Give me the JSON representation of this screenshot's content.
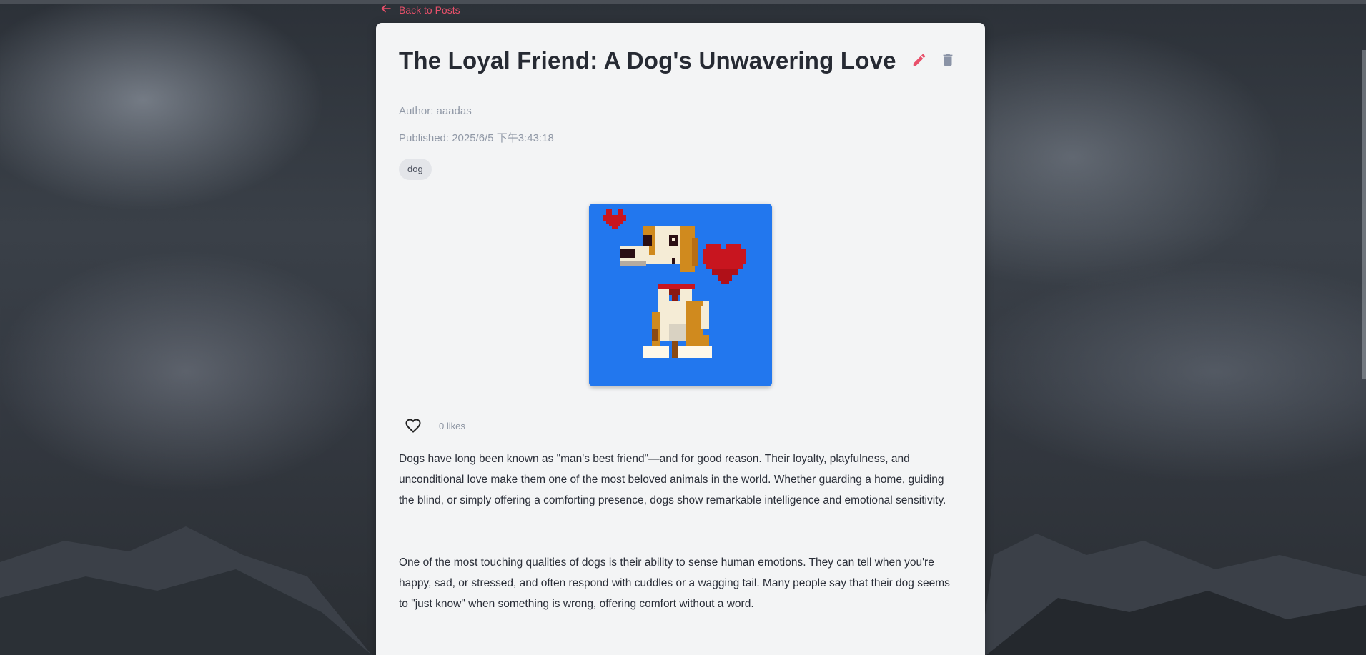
{
  "nav": {
    "back_label": "Back to Posts"
  },
  "post": {
    "title": "The Loyal Friend: A Dog's Unwavering Love",
    "author_line": "Author: aaadas",
    "published_line": "Published: 2025/6/5 下午3:43:18",
    "tags": [
      "dog"
    ],
    "likes_text": "0 likes",
    "paragraphs": [
      "Dogs have long been known as \"man's best friend\"—and for good reason. Their loyalty, playfulness, and unconditional love make them one of the most beloved animals in the world. Whether guarding a home, guiding the blind, or simply offering a comforting presence, dogs show remarkable intelligence and emotional sensitivity.",
      "One of the most touching qualities of dogs is their ability to sense human emotions. They can tell when you're happy, sad, or stressed, and often respond with cuddles or a wagging tail. Many people say that their dog seems to \"just know\" when something is wrong, offering comfort without a word."
    ]
  },
  "icons": {
    "back": "arrow-left-icon",
    "edit": "pencil-icon",
    "delete": "trash-icon",
    "like": "heart-outline-icon"
  },
  "colors": {
    "accent": "#e8506a",
    "card_bg": "#f3f4f5",
    "image_bg": "#2277ee",
    "muted": "#9098a6"
  }
}
